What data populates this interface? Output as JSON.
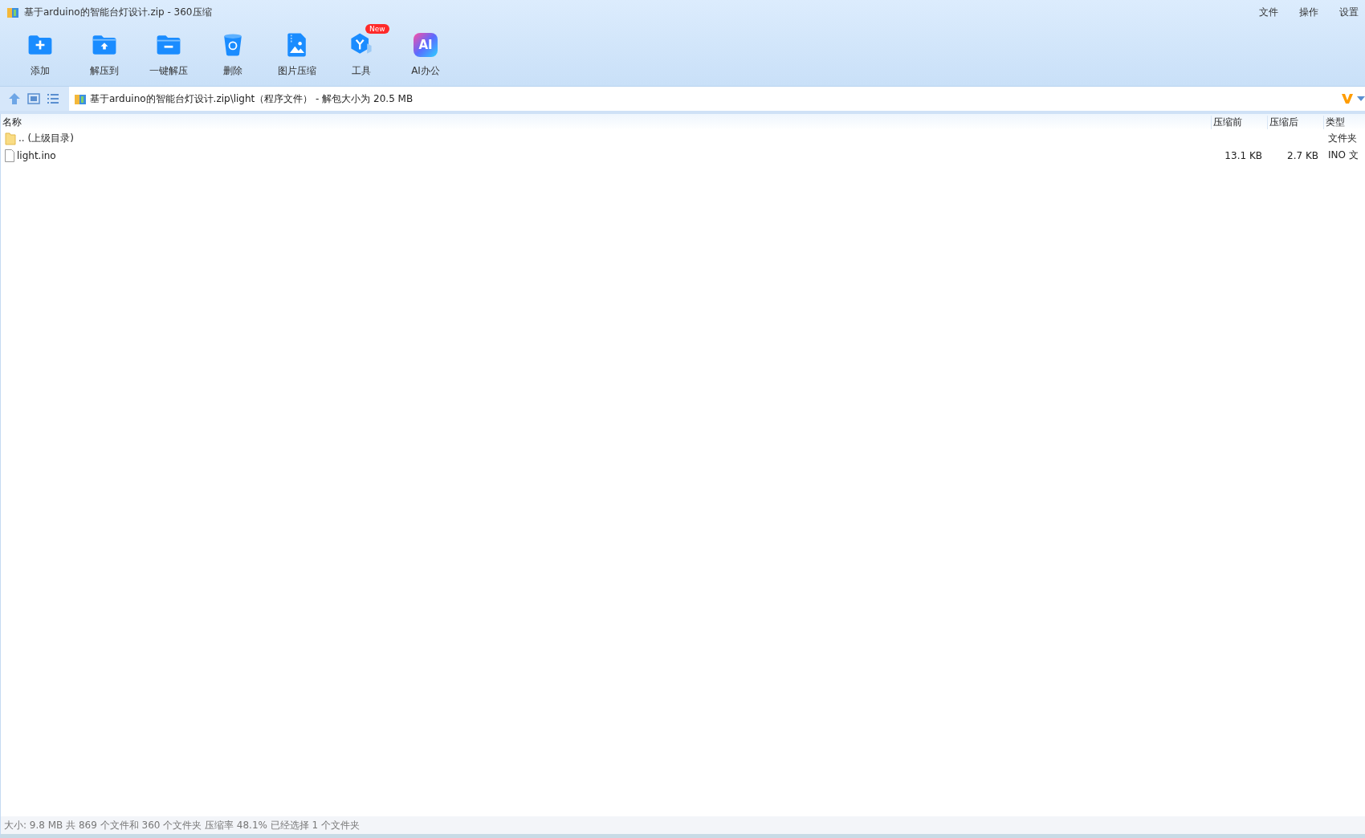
{
  "window": {
    "title": "基于arduino的智能台灯设计.zip - 360压缩"
  },
  "menu": [
    "文件",
    "操作",
    "设置"
  ],
  "toolbar": [
    {
      "label": "添加",
      "kind": "add"
    },
    {
      "label": "解压到",
      "kind": "extract"
    },
    {
      "label": "一键解压",
      "kind": "oneclick"
    },
    {
      "label": "删除",
      "kind": "delete"
    },
    {
      "label": "图片压缩",
      "kind": "image"
    },
    {
      "label": "工具",
      "kind": "tools",
      "badge": "New"
    },
    {
      "label": "AI办公",
      "kind": "ai",
      "icon_text": "AI"
    }
  ],
  "address": {
    "path": "基于arduino的智能台灯设计.zip\\light（程序文件）",
    "info": " - 解包大小为 20.5 MB"
  },
  "table": {
    "columns": [
      "名称",
      "压缩前",
      "压缩后",
      "类型"
    ],
    "rows": [
      {
        "kind": "folder",
        "name": ".. (上级目录)",
        "type": "文件夹"
      },
      {
        "kind": "file",
        "name": "light.ino",
        "before": "13.1 KB",
        "after": "2.7 KB",
        "type": "INO 文"
      }
    ]
  },
  "status_bar": "大小: 9.8 MB 共 869 个文件和 360 个文件夹 压缩率 48.1% 已经选择 1 个文件夹"
}
